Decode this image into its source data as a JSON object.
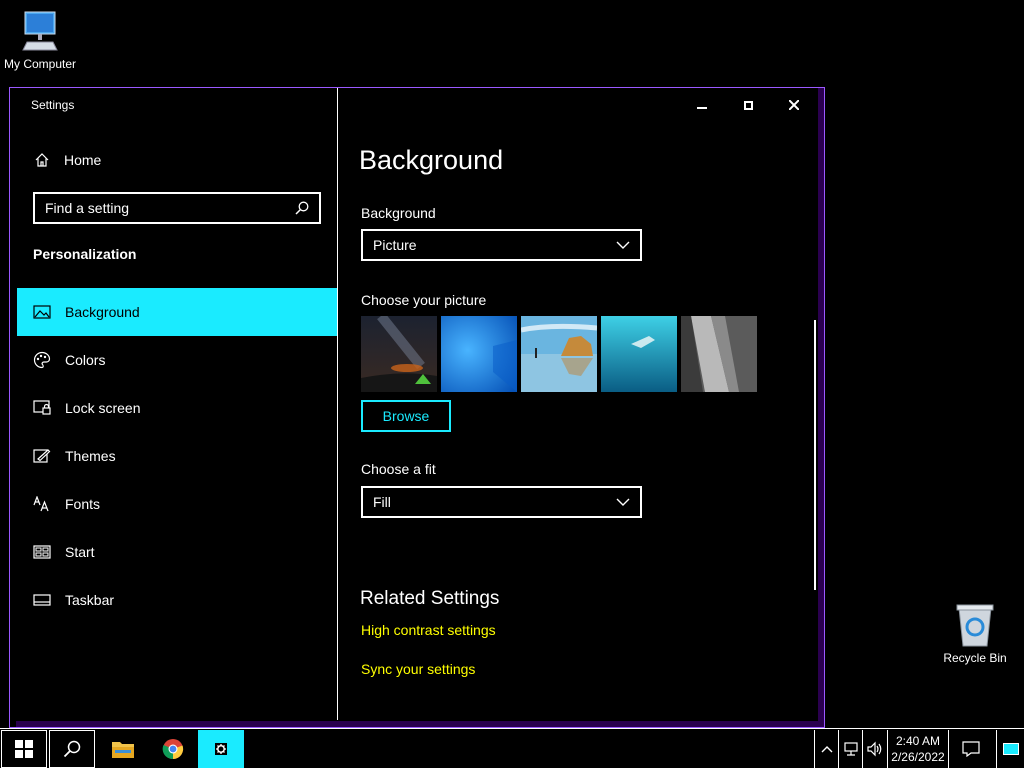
{
  "desktop": {
    "my_computer_label": "My Computer",
    "recycle_bin_label": "Recycle Bin"
  },
  "window": {
    "title": "Settings"
  },
  "sidebar": {
    "home_label": "Home",
    "search_placeholder": "Find a setting",
    "section_title": "Personalization",
    "items": [
      {
        "label": "Background",
        "icon": "picture-icon",
        "active": true
      },
      {
        "label": "Colors",
        "icon": "palette-icon",
        "active": false
      },
      {
        "label": "Lock screen",
        "icon": "lock-screen-icon",
        "active": false
      },
      {
        "label": "Themes",
        "icon": "brush-icon",
        "active": false
      },
      {
        "label": "Fonts",
        "icon": "fonts-icon",
        "active": false
      },
      {
        "label": "Start",
        "icon": "start-icon",
        "active": false
      },
      {
        "label": "Taskbar",
        "icon": "taskbar-icon",
        "active": false
      }
    ]
  },
  "main": {
    "title": "Background",
    "background_label": "Background",
    "background_value": "Picture",
    "choose_picture_label": "Choose your picture",
    "browse_label": "Browse",
    "fit_label": "Choose a fit",
    "fit_value": "Fill",
    "related_title": "Related Settings",
    "links": [
      "High contrast settings",
      "Sync your settings"
    ]
  },
  "taskbar": {
    "time": "2:40 AM",
    "date": "2/26/2022"
  },
  "colors": {
    "accent": "#1aebff",
    "link": "#ffff00",
    "window_border": "#9b59ff"
  }
}
